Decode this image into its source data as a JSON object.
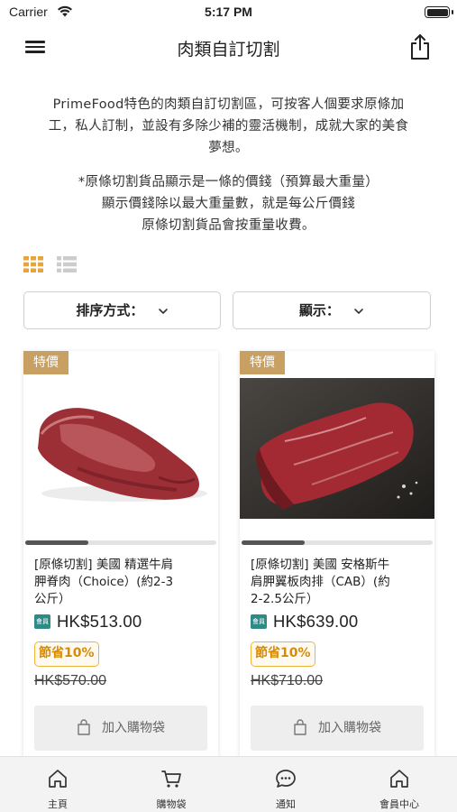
{
  "status_bar": {
    "carrier": "Carrier",
    "time": "5:17 PM"
  },
  "header": {
    "title": "肉類自訂切割"
  },
  "intro": {
    "lines": [
      "PrimeFood特色的肉類自訂切割區，可按客人個要求原條加",
      "工，私人訂制，並設有多除少補的靈活機制，成就大家的美食",
      "夢想。"
    ],
    "note_lines": [
      "*原條切割貨品顯示是一條的價錢（預算最大重量）",
      "顯示價錢除以最大重量數，就是每公斤價錢",
      "原條切割貨品會按重量收費。"
    ]
  },
  "view_toggle": {
    "grid_color": "#e8a33a",
    "list_color": "#cccccc"
  },
  "filters": {
    "sort_label": "排序方式：",
    "show_label": "顯示："
  },
  "products": [
    {
      "badge": "特價",
      "name_lines": [
        "[原條切割] 美國 精選牛肩",
        "胛脊肉（Choice）(約2-3",
        "公斤）"
      ],
      "member_icon": "會員",
      "price": "HK$513.00",
      "saving": "節省10%",
      "original_price": "HK$570.00",
      "add_label": "加入購物袋",
      "scroll_progress": 0.33
    },
    {
      "badge": "特價",
      "name_lines": [
        "[原條切割] 美國 安格斯牛",
        "肩胛翼板肉排（CAB）(約",
        "2-2.5公斤）"
      ],
      "member_icon": "會員",
      "price": "HK$639.00",
      "saving": "節省10%",
      "original_price": "HK$710.00",
      "add_label": "加入購物袋",
      "scroll_progress": 0.33
    }
  ],
  "tabs": [
    {
      "label": "主頁",
      "icon": "home-icon"
    },
    {
      "label": "購物袋",
      "icon": "cart-icon"
    },
    {
      "label": "通知",
      "icon": "chat-icon"
    },
    {
      "label": "會員中心",
      "icon": "member-home-icon"
    }
  ],
  "colors": {
    "badge": "#c9a063",
    "member_icon": "#2d8a86",
    "saving": "#f0b43a",
    "accent": "#e8a33a"
  }
}
